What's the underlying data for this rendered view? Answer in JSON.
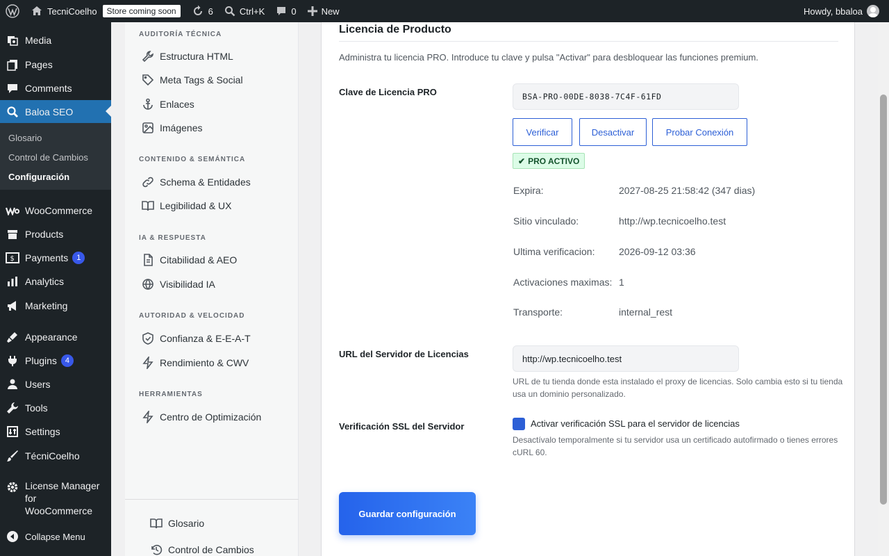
{
  "admin_bar": {
    "site_name": "TecniCoelho",
    "store_badge": "Store coming soon",
    "updates_count": "6",
    "search_label": "Ctrl+K",
    "comments_count": "0",
    "new_label": "New",
    "greeting": "Howdy, bbaloa"
  },
  "admin_menu": {
    "items": [
      {
        "label": "Media",
        "icon": "media-icon"
      },
      {
        "label": "Pages",
        "icon": "pages-icon"
      },
      {
        "label": "Comments",
        "icon": "comments-icon"
      },
      {
        "label": "Baloa SEO",
        "icon": "search-icon"
      },
      {
        "label": "WooCommerce",
        "icon": "woocommerce-icon"
      },
      {
        "label": "Products",
        "icon": "products-icon"
      },
      {
        "label": "Payments",
        "icon": "payments-icon",
        "badge": "1"
      },
      {
        "label": "Analytics",
        "icon": "analytics-icon"
      },
      {
        "label": "Marketing",
        "icon": "marketing-icon"
      },
      {
        "label": "Appearance",
        "icon": "appearance-icon"
      },
      {
        "label": "Plugins",
        "icon": "plugins-icon",
        "badge": "4"
      },
      {
        "label": "Users",
        "icon": "users-icon"
      },
      {
        "label": "Tools",
        "icon": "tools-icon"
      },
      {
        "label": "Settings",
        "icon": "settings-icon"
      },
      {
        "label": "TécniCoelho",
        "icon": "brush-icon"
      },
      {
        "label": "License Manager for WooCommerce",
        "icon": "gear-icon"
      },
      {
        "label": "Collapse Menu",
        "icon": "collapse-icon"
      }
    ],
    "submenu": [
      "Glosario",
      "Control de Cambios",
      "Configuración"
    ]
  },
  "plugin_nav": {
    "sections": [
      {
        "title": "AUDITORÍA TÉCNICA",
        "links": [
          "Estructura HTML",
          "Meta Tags & Social",
          "Enlaces",
          "Imágenes"
        ]
      },
      {
        "title": "CONTENIDO & SEMÁNTICA",
        "links": [
          "Schema & Entidades",
          "Legibilidad & UX"
        ]
      },
      {
        "title": "IA & RESPUESTA",
        "links": [
          "Citabilidad & AEO",
          "Visibilidad IA"
        ]
      },
      {
        "title": "AUTORIDAD & VELOCIDAD",
        "links": [
          "Confianza & E-E-A-T",
          "Rendimiento & CWV"
        ]
      },
      {
        "title": "HERRAMIENTAS",
        "links": [
          "Centro de Optimización"
        ]
      }
    ],
    "footer_links": [
      "Glosario",
      "Control de Cambios"
    ]
  },
  "license": {
    "title": "Licencia de Producto",
    "description": "Administra tu licencia PRO. Introduce tu clave y pulsa \"Activar\" para desbloquear las funciones premium.",
    "key_label": "Clave de Licencia PRO",
    "key_value": "BSA-PRO-00DE-8038-7C4F-61FD",
    "buttons": {
      "verify": "Verificar",
      "deactivate": "Desactivar",
      "test": "Probar Conexión"
    },
    "status_badge": "PRO ACTIVO",
    "details": [
      {
        "label": "Expira:",
        "value": "2027-08-25 21:58:42 (347 dias)"
      },
      {
        "label": "Sitio vinculado:",
        "value": "http://wp.tecnicoelho.test"
      },
      {
        "label": "Ultima verificacion:",
        "value": "2026-09-12 03:36"
      },
      {
        "label": "Activaciones maximas:",
        "value": "1"
      },
      {
        "label": "Transporte:",
        "value": "internal_rest"
      }
    ],
    "server_url_label": "URL del Servidor de Licencias",
    "server_url_value": "http://wp.tecnicoelho.test",
    "server_url_help": "URL de tu tienda donde esta instalado el proxy de licencias. Solo cambia esto si tu tienda usa un dominio personalizado.",
    "ssl_label": "Verificación SSL del Servidor",
    "ssl_checkbox_label": "Activar verificación SSL para el servidor de licencias",
    "ssl_checked": true,
    "ssl_help": "Desactívalo temporalmente si tu servidor usa un certificado autofirmado o tienes errores cURL 60.",
    "save_label": "Guardar configuración"
  },
  "colors": {
    "admin_bg": "#1d2327",
    "accent": "#2271b1",
    "primary_button": "#2563eb",
    "badge_green_bg": "#dcfce7"
  }
}
